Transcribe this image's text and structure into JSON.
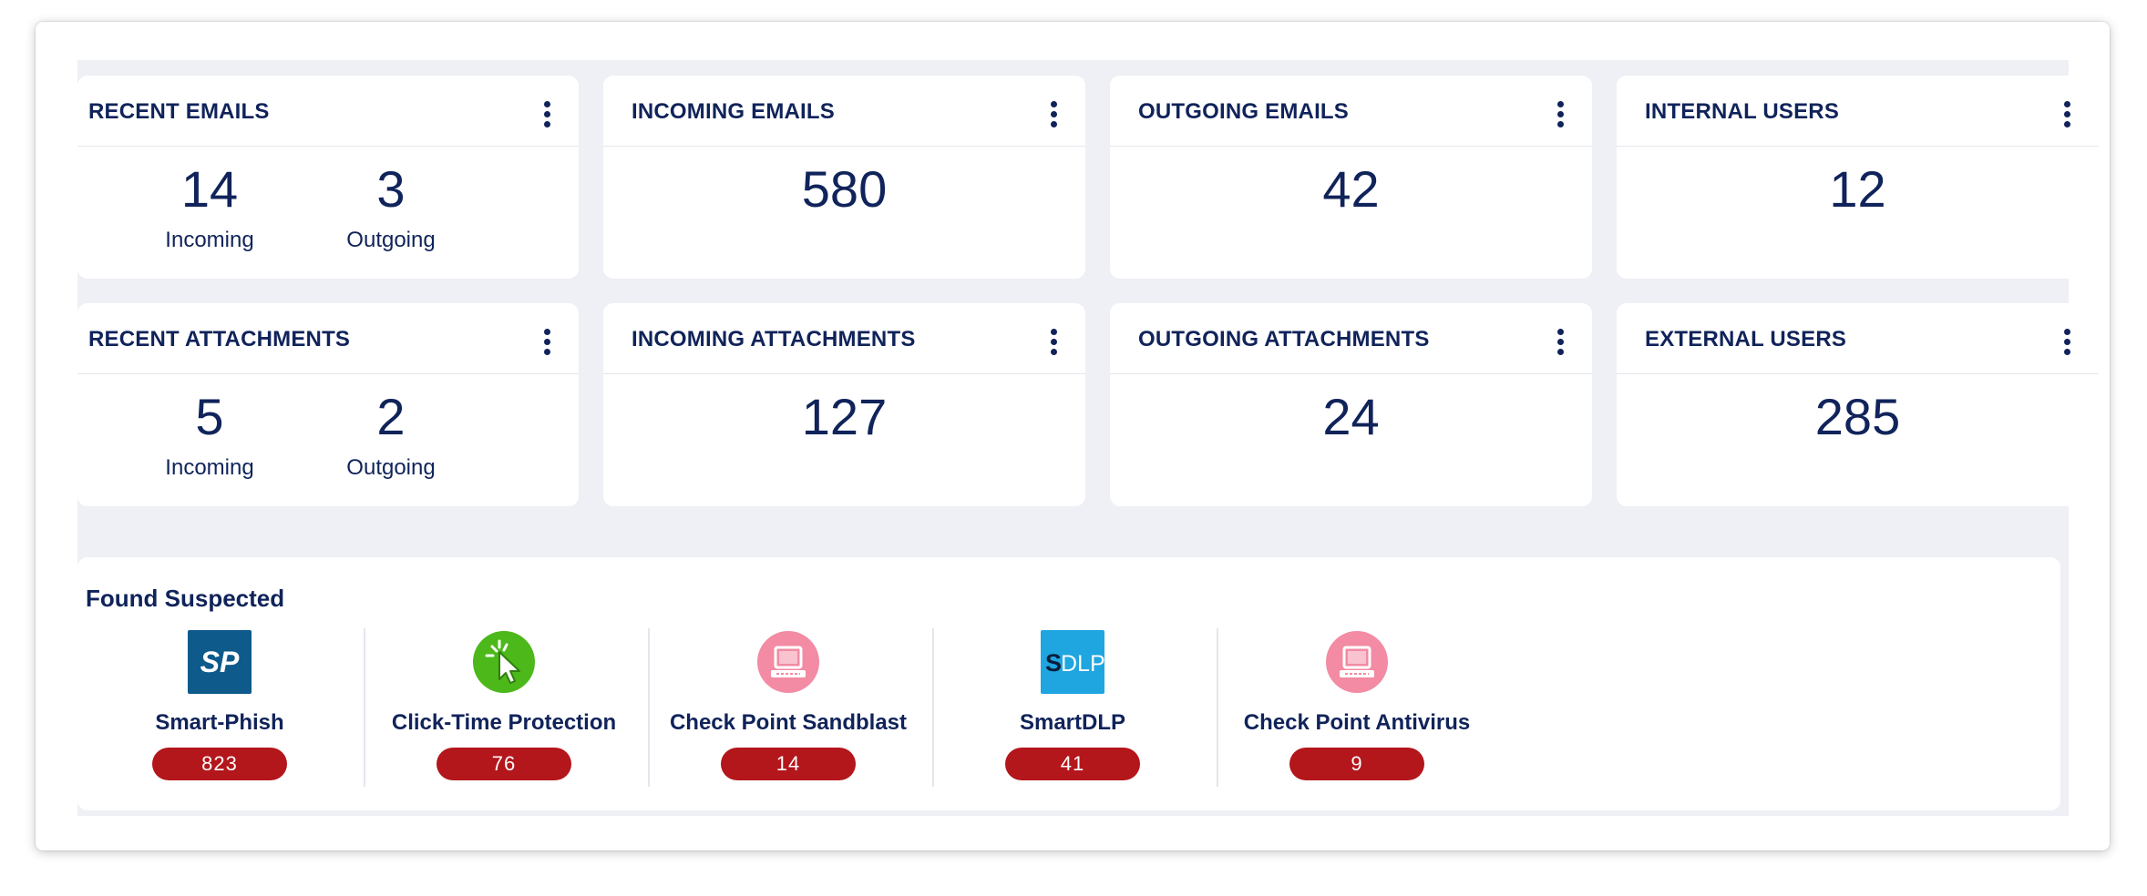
{
  "colors": {
    "text": "#10235a",
    "background": "#eef0f5",
    "card": "#ffffff",
    "badge": "#b3161b",
    "smartphish_icon": "#0e5a8a",
    "clicktime_icon": "#4cb81a",
    "checkpoint_icon": "#f28ba3",
    "smartdlp_icon": "#1fa5df"
  },
  "row1": {
    "recent_emails": {
      "title": "RECENT EMAILS",
      "incoming_value": "14",
      "incoming_label": "Incoming",
      "outgoing_value": "3",
      "outgoing_label": "Outgoing"
    },
    "incoming_emails": {
      "title": "INCOMING EMAILS",
      "value": "580"
    },
    "outgoing_emails": {
      "title": "OUTGOING EMAILS",
      "value": "42"
    },
    "internal_users": {
      "title": "INTERNAL USERS",
      "value": "12"
    }
  },
  "row2": {
    "recent_attachments": {
      "title": "RECENT ATTACHMENTS",
      "incoming_value": "5",
      "incoming_label": "Incoming",
      "outgoing_value": "2",
      "outgoing_label": "Outgoing"
    },
    "incoming_attachments": {
      "title": "INCOMING ATTACHMENTS",
      "value": "127"
    },
    "outgoing_attachments": {
      "title": "OUTGOING ATTACHMENTS",
      "value": "24"
    },
    "external_users": {
      "title": "EXTERNAL USERS",
      "value": "285"
    }
  },
  "found_suspected": {
    "title": "Found Suspected",
    "tools": [
      {
        "name": "Smart-Phish",
        "count": "823",
        "icon": "smart-phish-logo-icon"
      },
      {
        "name": "Click-Time Protection",
        "count": "76",
        "icon": "cursor-click-icon"
      },
      {
        "name": "Check Point Sandblast",
        "count": "14",
        "icon": "computer-monitor-icon"
      },
      {
        "name": "SmartDLP",
        "count": "41",
        "icon": "smartdlp-logo-icon"
      },
      {
        "name": "Check Point Antivirus",
        "count": "9",
        "icon": "computer-monitor-icon"
      }
    ]
  }
}
